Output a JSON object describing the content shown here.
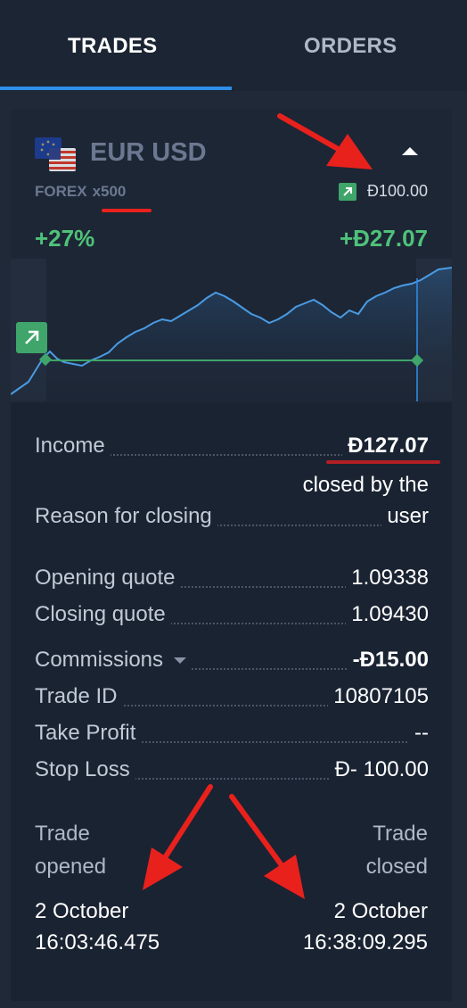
{
  "tabs": {
    "trades": "TRADES",
    "orders": "ORDERS"
  },
  "trade": {
    "asset": "EUR USD",
    "market": "FOREX",
    "leverage": "x500",
    "investment": "Đ100.00",
    "profit_percent": "+27%",
    "profit_amount": "+Đ27.07"
  },
  "details": {
    "income_label": "Income",
    "income_value": "Đ127.07",
    "reason_label": "Reason for closing",
    "reason_value_line1": "closed by the",
    "reason_value_line2": "user",
    "opening_label": "Opening quote",
    "opening_value": "1.09338",
    "closing_label": "Closing quote",
    "closing_value": "1.09430",
    "commissions_label": "Commissions",
    "commissions_value": "-Đ15.00",
    "trade_id_label": "Trade ID",
    "trade_id_value": "10807105",
    "take_profit_label": "Take Profit",
    "take_profit_value": "--",
    "stop_loss_label": "Stop Loss",
    "stop_loss_value": "Đ- 100.00"
  },
  "times": {
    "opened_label_1": "Trade",
    "opened_label_2": "opened",
    "opened_date": "2 October",
    "opened_time": "16:03:46.475",
    "closed_label_1": "Trade",
    "closed_label_2": "closed",
    "closed_date": "2 October",
    "closed_time": "16:38:09.295"
  },
  "colors": {
    "background": "#1f2937",
    "accent": "#2f8ee8",
    "profit": "#4fc27a",
    "chart_line": "#4a9be3",
    "annotation": "#e8211d"
  },
  "icons": {
    "flag": "eu-us-flag-icon",
    "collapse": "chevron-up-icon",
    "direction": "arrow-up-right-icon"
  }
}
